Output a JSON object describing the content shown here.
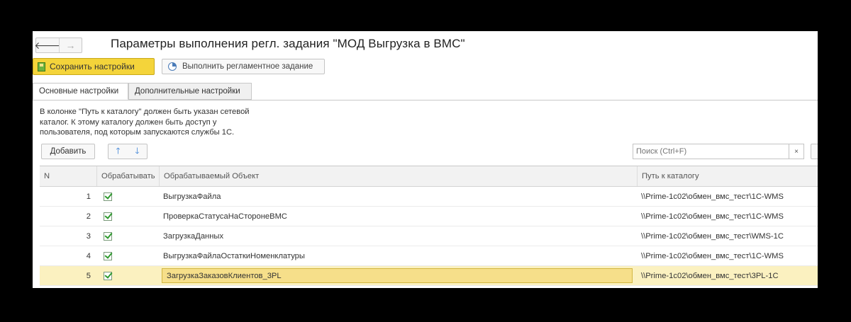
{
  "window": {
    "title": "Параметры выполнения регл. задания \"МОД Выгрузка в ВМС\"",
    "nav": {
      "back_icon": "arrow-left-icon",
      "back_glyph": "🡐",
      "forward_icon": "arrow-right-icon",
      "forward_glyph": "→"
    }
  },
  "toolbar": {
    "save_label": "Сохранить настройки",
    "run_label": "Выполнить регламентное задание",
    "accent_color": "#f4d43a"
  },
  "tabs": [
    {
      "label": "Основные настройки",
      "active": true
    },
    {
      "label": "Дополнительные настройки",
      "active": false
    }
  ],
  "info_lines": [
    "В колонке \"Путь к каталогу\" должен быть указан сетевой",
    "каталог. К этому каталогу должен быть доступ у",
    "пользователя, под которым запускаются службы 1С."
  ],
  "table_toolbar": {
    "add_label": "Добавить",
    "up_glyph": "🡑",
    "down_glyph": "🡓",
    "search_placeholder": "Поиск (Ctrl+F)",
    "clear_glyph": "×"
  },
  "table": {
    "columns": [
      "N",
      "Обрабатывать",
      "Обрабатываемый Объект",
      "Путь к каталогу"
    ],
    "rows": [
      {
        "n": "1",
        "checked": true,
        "object": "ВыгрузкаФайла",
        "path": "\\\\Prime-1c02\\обмен_вмс_тест\\1C-WMS"
      },
      {
        "n": "2",
        "checked": true,
        "object": "ПроверкаСтатусаНаСторонеВМС",
        "path": "\\\\Prime-1c02\\обмен_вмс_тест\\1C-WMS"
      },
      {
        "n": "3",
        "checked": true,
        "object": "ЗагрузкаДанных",
        "path": "\\\\Prime-1c02\\обмен_вмс_тест\\WMS-1C"
      },
      {
        "n": "4",
        "checked": true,
        "object": "ВыгрузкаФайлаОстаткиНоменклатуры",
        "path": "\\\\Prime-1c02\\обмен_вмс_тест\\1C-WMS"
      },
      {
        "n": "5",
        "checked": true,
        "object": "ЗагрузкаЗаказовКлиентов_3PL",
        "path": "\\\\Prime-1c02\\обмен_вмс_тест\\3PL-1C",
        "selected": true
      }
    ]
  }
}
